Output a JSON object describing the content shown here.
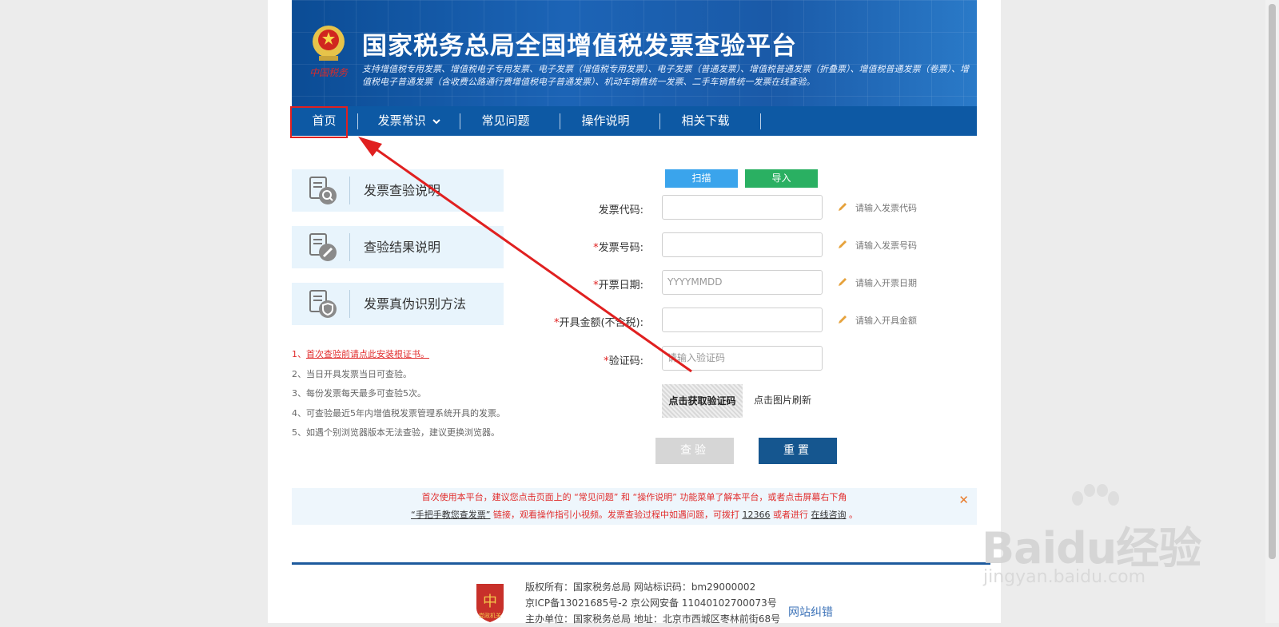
{
  "banner": {
    "title": "国家税务总局全国增值税发票查验平台",
    "subtitle": "支持增值税专用发票、增值税电子专用发票、电子发票（增值税专用发票）、电子发票（普通发票）、增值税普通发票（折叠票）、增值税普通发票（卷票）、增值税电子普通发票（含收费公路通行费增值税电子普通发票）、机动车销售统一发票、二手车销售统一发票在线查验。",
    "emblem_text": "中国税务"
  },
  "nav": {
    "items": [
      {
        "label": "首页"
      },
      {
        "label": "发票常识"
      },
      {
        "label": "常见问题"
      },
      {
        "label": "操作说明"
      },
      {
        "label": "相关下载"
      }
    ]
  },
  "side": {
    "cards": [
      {
        "label": "发票查验说明",
        "icon": "document-search-icon"
      },
      {
        "label": "查验结果说明",
        "icon": "document-edit-icon"
      },
      {
        "label": "发票真伪识别方法",
        "icon": "document-shield-icon"
      }
    ],
    "tips": [
      {
        "num": "1、",
        "text": "首次查验前请点此安装根证书。"
      },
      {
        "num": "2、",
        "text": "当日开具发票当日可查验。"
      },
      {
        "num": "3、",
        "text": "每份发票每天最多可查验5次。"
      },
      {
        "num": "4、",
        "text": "可查验最近5年内增值税发票管理系统开具的发票。"
      },
      {
        "num": "5、",
        "text": "如遇个别浏览器版本无法查验，建议更换浏览器。"
      }
    ]
  },
  "form": {
    "scan_label": "扫描",
    "import_label": "导入",
    "fields": [
      {
        "label": "发票代码:",
        "required": "",
        "placeholder": "",
        "hint": "请输入发票代码"
      },
      {
        "label": "发票号码:",
        "required": "*",
        "placeholder": "",
        "hint": "请输入发票号码"
      },
      {
        "label": "开票日期:",
        "required": "*",
        "placeholder": "YYYYMMDD",
        "hint": "请输入开票日期"
      },
      {
        "label": "开具金额(不含税):",
        "required": "*",
        "placeholder": "",
        "hint": "请输入开具金额"
      },
      {
        "label": "验证码:",
        "required": "*",
        "placeholder": "请输入验证码",
        "hint": ""
      }
    ],
    "captcha_text": "点击获取验证码",
    "captcha_refresh": "点击图片刷新",
    "check_label": "查验",
    "reset_label": "重置"
  },
  "notice": {
    "line1": "首次使用本平台，建议您点击页面上的 “常见问题” 和 “操作说明” 功能菜单了解本平台，或者点击屏幕右下角",
    "link_tutorial": "“手把手教您查发票”",
    "line2_a": " 链接，观看操作指引小视频。发票查验过程中如遇问题，可拨打 ",
    "hotline": "12366",
    "line2_b": " 或者进行 ",
    "online": "在线咨询",
    "line2_c": " 。",
    "close": "✕"
  },
  "footer": {
    "line1": "版权所有：国家税务总局 网站标识码：bm29000002",
    "line2": "京ICP备13021685号-2 京公网安备 11040102700073号",
    "line3": "主办单位：国家税务总局 地址：北京市西城区枣林前街68号",
    "report_link": "网站纠错",
    "logo_text": "党政机关"
  },
  "watermark": {
    "brand": "Baidu经验",
    "url": "jingyan.baidu.com"
  },
  "colors": {
    "nav_bg": "#0d59a4",
    "scan_btn": "#3aa4ec",
    "import_btn": "#2ab062",
    "reset_btn": "#15568f",
    "check_btn": "#d6d6d6",
    "annotation_red": "#e02020"
  }
}
